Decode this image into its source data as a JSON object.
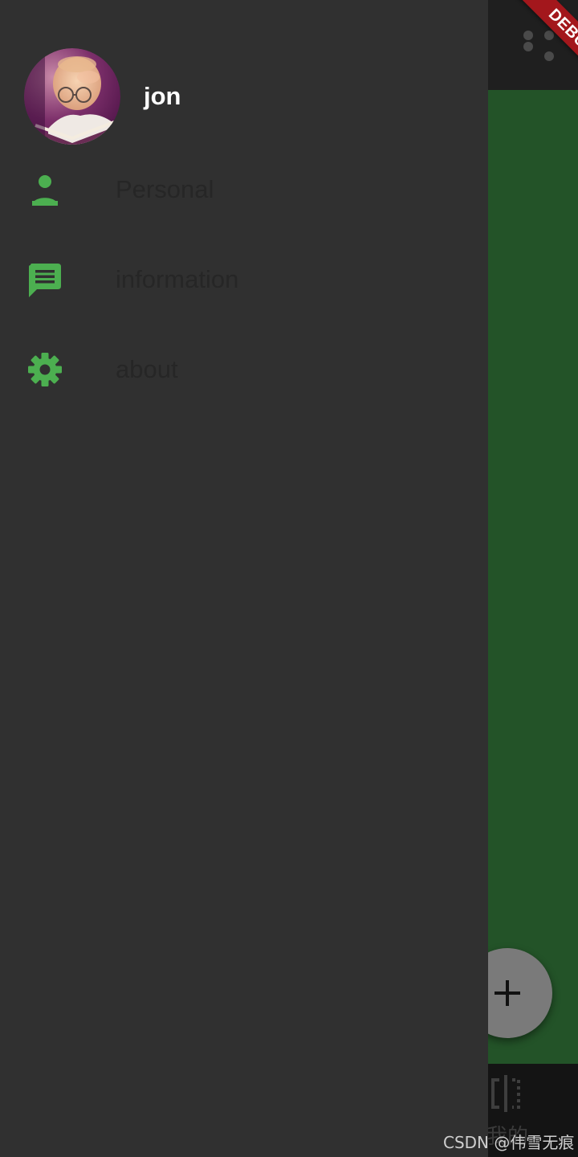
{
  "drawer": {
    "user_name": "jon",
    "menu_items": [
      {
        "label": "Personal",
        "icon": "person-icon"
      },
      {
        "label": "information",
        "icon": "message-icon"
      },
      {
        "label": "about",
        "icon": "gear-icon"
      }
    ]
  },
  "debug_banner": {
    "label": "DEBUG"
  },
  "fab": {
    "icon": "plus-icon"
  },
  "bottom_nav": {
    "item_label": "我的",
    "item_icon": "split-view-icon"
  },
  "watermark": "CSDN @伟雪无痕",
  "colors": {
    "drawer_bg": "#303030",
    "accent_green": "#4caf50",
    "app_body_green": "#235328",
    "debug_red": "#a3171c"
  }
}
